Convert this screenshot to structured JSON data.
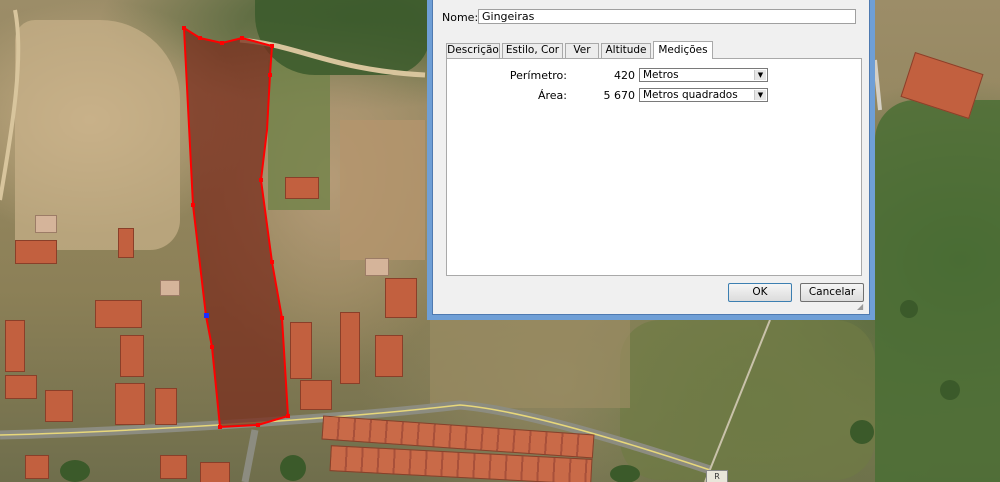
{
  "dialog": {
    "name_label": "Nome:",
    "name_value": "Gingeiras",
    "tabs": [
      {
        "label": "Descrição"
      },
      {
        "label": "Estilo, Cor"
      },
      {
        "label": "Ver"
      },
      {
        "label": "Altitude"
      },
      {
        "label": "Medições",
        "active": true
      }
    ],
    "measurements": {
      "perimeter_label": "Perímetro:",
      "perimeter_value": "420",
      "perimeter_unit": "Metros",
      "area_label": "Área:",
      "area_value": "5 670",
      "area_unit": "Metros quadrados"
    },
    "ok_label": "OK",
    "cancel_label": "Cancelar"
  },
  "map": {
    "polygon_color": "#ff0000",
    "road_label": "R"
  },
  "colors": {
    "dialog_frame": "#6f9fd6",
    "dialog_body": "#f0f0f0",
    "polygon_fill": "#7a2d1e"
  }
}
